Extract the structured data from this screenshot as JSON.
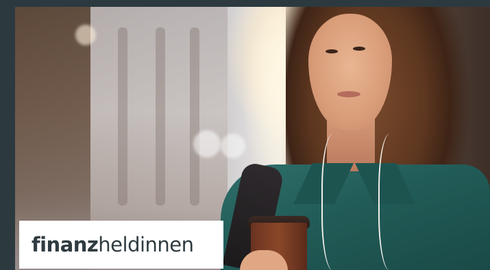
{
  "brand": {
    "name_bold": "finanz",
    "name_light": "heldinnen"
  },
  "photo": {
    "subject": "woman-with-coffee-and-earphones"
  },
  "colors": {
    "frame": "#2c3a40",
    "logo_background": "#ffffff",
    "logo_text": "#2f3b40"
  }
}
